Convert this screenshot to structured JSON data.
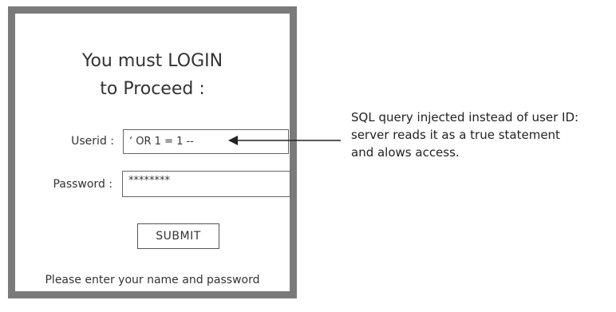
{
  "login": {
    "title": "You must LOGIN\nto Proceed :",
    "userid_label": "Userid :",
    "userid_value": "‘ OR 1 = 1 --",
    "password_label": "Password :",
    "password_value": "********",
    "submit_label": "SUBMIT",
    "hint": "Please enter your name and password"
  },
  "annotation": {
    "lines": [
      "SQL query injected instead of user ID:",
      "server reads it as a true statement",
      "and alows access."
    ]
  },
  "colors": {
    "frame": "#7a7a7a",
    "text": "#333333"
  }
}
